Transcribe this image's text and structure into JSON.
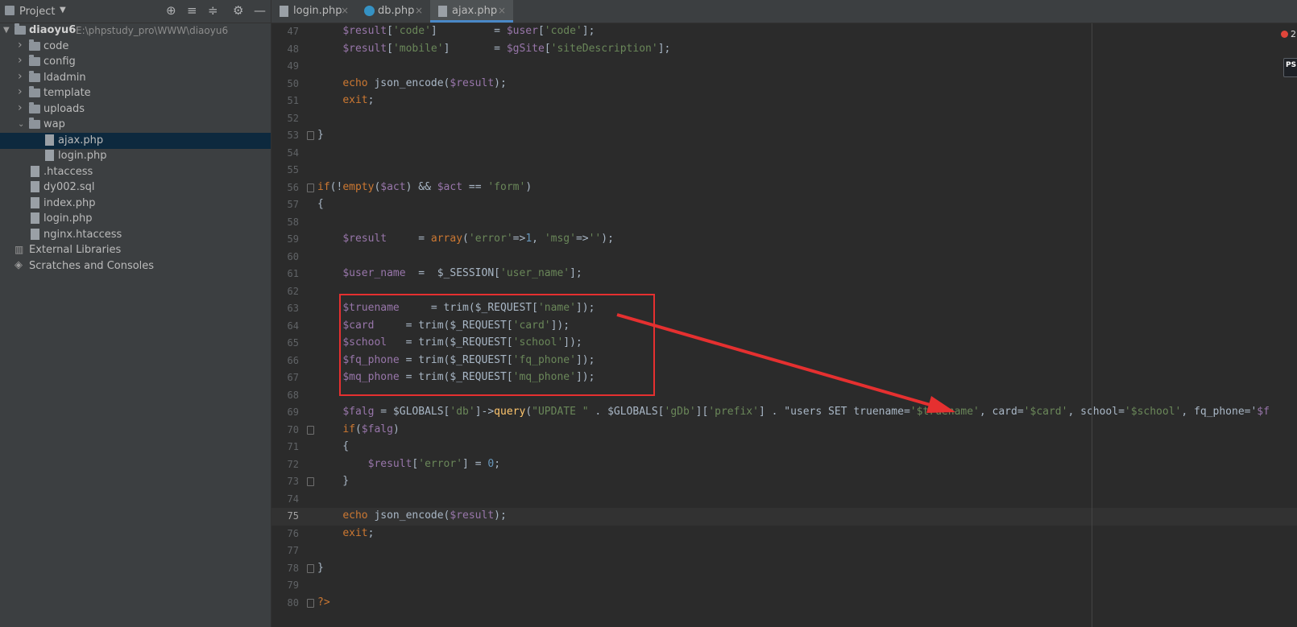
{
  "project": {
    "title": "Project",
    "tree": [
      {
        "type": "root",
        "name": "diaoyu6",
        "path": "E:\\phpstudy_pro\\WWW\\diaoyu6"
      },
      {
        "type": "folder",
        "name": "code"
      },
      {
        "type": "folder",
        "name": "config"
      },
      {
        "type": "folder",
        "name": "ldadmin"
      },
      {
        "type": "folder",
        "name": "template"
      },
      {
        "type": "folder",
        "name": "uploads"
      },
      {
        "type": "folder-open",
        "name": "wap"
      },
      {
        "type": "php",
        "name": "ajax.php"
      },
      {
        "type": "php",
        "name": "login.php"
      },
      {
        "type": "htaccess",
        "name": ".htaccess"
      },
      {
        "type": "sql",
        "name": "dy002.sql"
      },
      {
        "type": "php",
        "name": "index.php"
      },
      {
        "type": "php",
        "name": "login.php"
      },
      {
        "type": "htaccess",
        "name": "nginx.htaccess"
      },
      {
        "type": "lib",
        "name": "External Libraries"
      },
      {
        "type": "scratch",
        "name": "Scratches and Consoles"
      }
    ]
  },
  "tabs": [
    {
      "label": "login.php",
      "icon": "php-file-icon"
    },
    {
      "label": "db.php",
      "icon": "class-file-icon"
    },
    {
      "label": "ajax.php",
      "icon": "php-file-icon",
      "active": true
    }
  ],
  "editor": {
    "current_line": "75",
    "error_count": "2",
    "ps_badge": "PS",
    "lines": [
      {
        "n": "47",
        "t": "    $result['code']         = $user['code'];"
      },
      {
        "n": "48",
        "t": "    $result['mobile']       = $gSite['siteDescription'];"
      },
      {
        "n": "49",
        "t": ""
      },
      {
        "n": "50",
        "t": "    echo json_encode($result);"
      },
      {
        "n": "51",
        "t": "    exit;"
      },
      {
        "n": "52",
        "t": ""
      },
      {
        "n": "53",
        "t": "}"
      },
      {
        "n": "54",
        "t": ""
      },
      {
        "n": "55",
        "t": ""
      },
      {
        "n": "56",
        "t": "if(!empty($act) && $act == 'form')"
      },
      {
        "n": "57",
        "t": "{"
      },
      {
        "n": "58",
        "t": ""
      },
      {
        "n": "59",
        "t": "    $result     = array('error'=>1, 'msg'=>'');"
      },
      {
        "n": "60",
        "t": ""
      },
      {
        "n": "61",
        "t": "    $user_name  =  $_SESSION['user_name'];"
      },
      {
        "n": "62",
        "t": ""
      },
      {
        "n": "63",
        "t": "    $truename     = trim($_REQUEST['name']);"
      },
      {
        "n": "64",
        "t": "    $card     = trim($_REQUEST['card']);"
      },
      {
        "n": "65",
        "t": "    $school   = trim($_REQUEST['school']);"
      },
      {
        "n": "66",
        "t": "    $fq_phone = trim($_REQUEST['fq_phone']);"
      },
      {
        "n": "67",
        "t": "    $mq_phone = trim($_REQUEST['mq_phone']);"
      },
      {
        "n": "68",
        "t": ""
      },
      {
        "n": "69",
        "t": "    $falg = $GLOBALS['db']->query(\"UPDATE \" . $GLOBALS['gDb']['prefix'] . \"users SET truename='$truename', card='$card', school='$school', fq_phone='$f"
      },
      {
        "n": "70",
        "t": "    if($falg)"
      },
      {
        "n": "71",
        "t": "    {"
      },
      {
        "n": "72",
        "t": "        $result['error'] = 0;"
      },
      {
        "n": "73",
        "t": "    }"
      },
      {
        "n": "74",
        "t": ""
      },
      {
        "n": "75",
        "t": "    echo json_encode($result);"
      },
      {
        "n": "76",
        "t": "    exit;"
      },
      {
        "n": "77",
        "t": ""
      },
      {
        "n": "78",
        "t": "}"
      },
      {
        "n": "79",
        "t": ""
      },
      {
        "n": "80",
        "t": "?>"
      }
    ]
  },
  "colors": {
    "annotation_red": "#e53030",
    "tab_underline": "#4a88c7"
  }
}
